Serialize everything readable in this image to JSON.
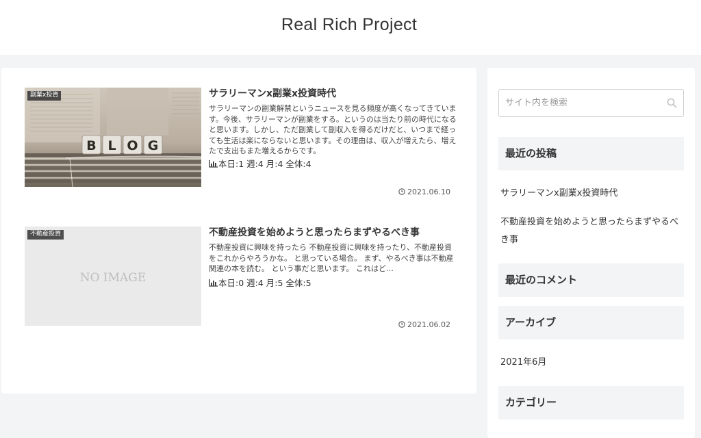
{
  "site": {
    "title": "Real Rich Project"
  },
  "posts": [
    {
      "category": "副業x投資",
      "title": "サラリーマンx副業x投資時代",
      "snippet": "サラリーマンの副業解禁というニュースを見る頻度が高くなってきています。今後、サラリーマンが副業をする。というのは当たり前の時代になると思います。しかし、ただ副業して副収入を得るだけだと、いつまで経っても生活は楽にならないと思います。その理由は、収入が増えたら、増えたで支出もまた増えるからです。",
      "pv": "本日:1 週:4 月:4 全体:4",
      "date": "2021.06.10",
      "thumb_text": "BLOG"
    },
    {
      "category": "不動産投資",
      "title": "不動産投資を始めようと思ったらまずやるべき事",
      "snippet": "不動産投資に興味を持ったら 不動産投資に興味を持ったり、不動産投資をこれからやろうかな。 と思っている場合。 まず、やるべき事は不動産関連の本を読む。 という事だと思います。 これはど…",
      "pv": "本日:0 週:4 月:5 全体:5",
      "date": "2021.06.02",
      "thumb_text": "NO IMAGE"
    }
  ],
  "sidebar": {
    "search_placeholder": "サイト内を検索",
    "recent_posts_heading": "最近の投稿",
    "recent_posts": [
      "サラリーマンx副業x投資時代",
      "不動産投資を始めようと思ったらまずやるべき事"
    ],
    "recent_comments_heading": "最近のコメント",
    "archives_heading": "アーカイブ",
    "archives": [
      "2021年6月"
    ],
    "categories_heading": "カテゴリー"
  },
  "icons": {
    "pv": "bar-chart-icon",
    "date": "clock-icon",
    "search": "search-icon"
  }
}
